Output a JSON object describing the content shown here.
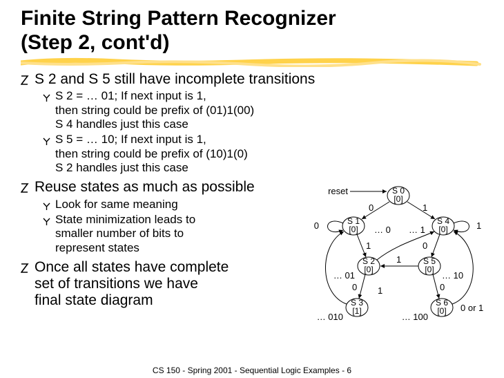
{
  "title_line1": "Finite String Pattern Recognizer",
  "title_line2": "(Step 2, cont'd)",
  "bullets": {
    "b1": {
      "text": "S 2 and S 5 still have incomplete transitions",
      "subs": [
        "S 2 = … 01; If next input is 1,\nthen string could be prefix of (01)1(00)\nS 4 handles just this case",
        "S 5 = … 10; If next input is 1,\nthen string could be prefix of (10)1(0)\nS 2 handles just this case"
      ]
    },
    "b2": {
      "text": "Reuse states as much as possible",
      "subs": [
        "Look for same meaning",
        "State minimization leads to\nsmaller number of bits to\nrepresent states"
      ]
    },
    "b3": {
      "text": "Once all states have complete\nset of transitions we have\nfinal state diagram"
    }
  },
  "diagram": {
    "reset": "reset",
    "states": {
      "s0": {
        "name": "S 0",
        "out": "[0]"
      },
      "s1": {
        "name": "S 1",
        "out": "[0]"
      },
      "s2": {
        "name": "S 2",
        "out": "[0]"
      },
      "s3": {
        "name": "S 3",
        "out": "[1]"
      },
      "s4": {
        "name": "S 4",
        "out": "[0]"
      },
      "s5": {
        "name": "S 5",
        "out": "[0]"
      },
      "s6": {
        "name": "S 6",
        "out": "[0]"
      }
    },
    "edge_labels": {
      "s0_s1": "0",
      "s0_s4": "1",
      "s1_s2": "1",
      "s1_loop": "0",
      "s2_s3": "0",
      "s2_s4": "1",
      "s4_s5": "0",
      "s4_loop": "1",
      "s5_s6": "0",
      "s5_s2": "1",
      "s3_s1": "… 010",
      "s6_s4": "… 100",
      "s2_pref": "… 01",
      "s5_pref": "… 10",
      "s1_pre": "… 0",
      "s4_pre": "… 1",
      "s6_any": "0 or 1"
    }
  },
  "footer": "CS 150 - Spring 2001 - Sequential Logic Examples - 6"
}
